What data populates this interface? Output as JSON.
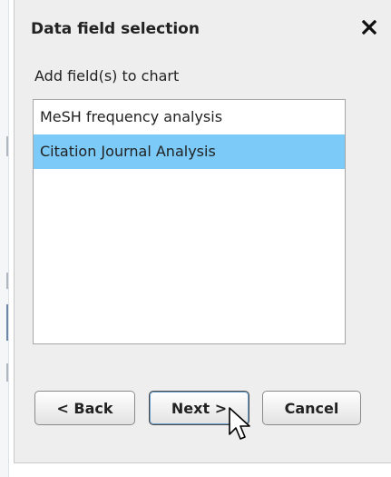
{
  "dialog": {
    "title": "Data field selection",
    "close_icon": "close-icon",
    "subtitle": "Add field(s) to chart"
  },
  "list": {
    "items": [
      {
        "label": "MeSH frequency analysis",
        "selected": false
      },
      {
        "label": "Citation Journal Analysis",
        "selected": true
      }
    ],
    "selected_color": "#7ccaf7"
  },
  "buttons": {
    "back_label": "< Back",
    "next_label": "Next >",
    "cancel_label": "Cancel"
  },
  "cursor": {
    "icon": "mouse-pointer-icon"
  }
}
